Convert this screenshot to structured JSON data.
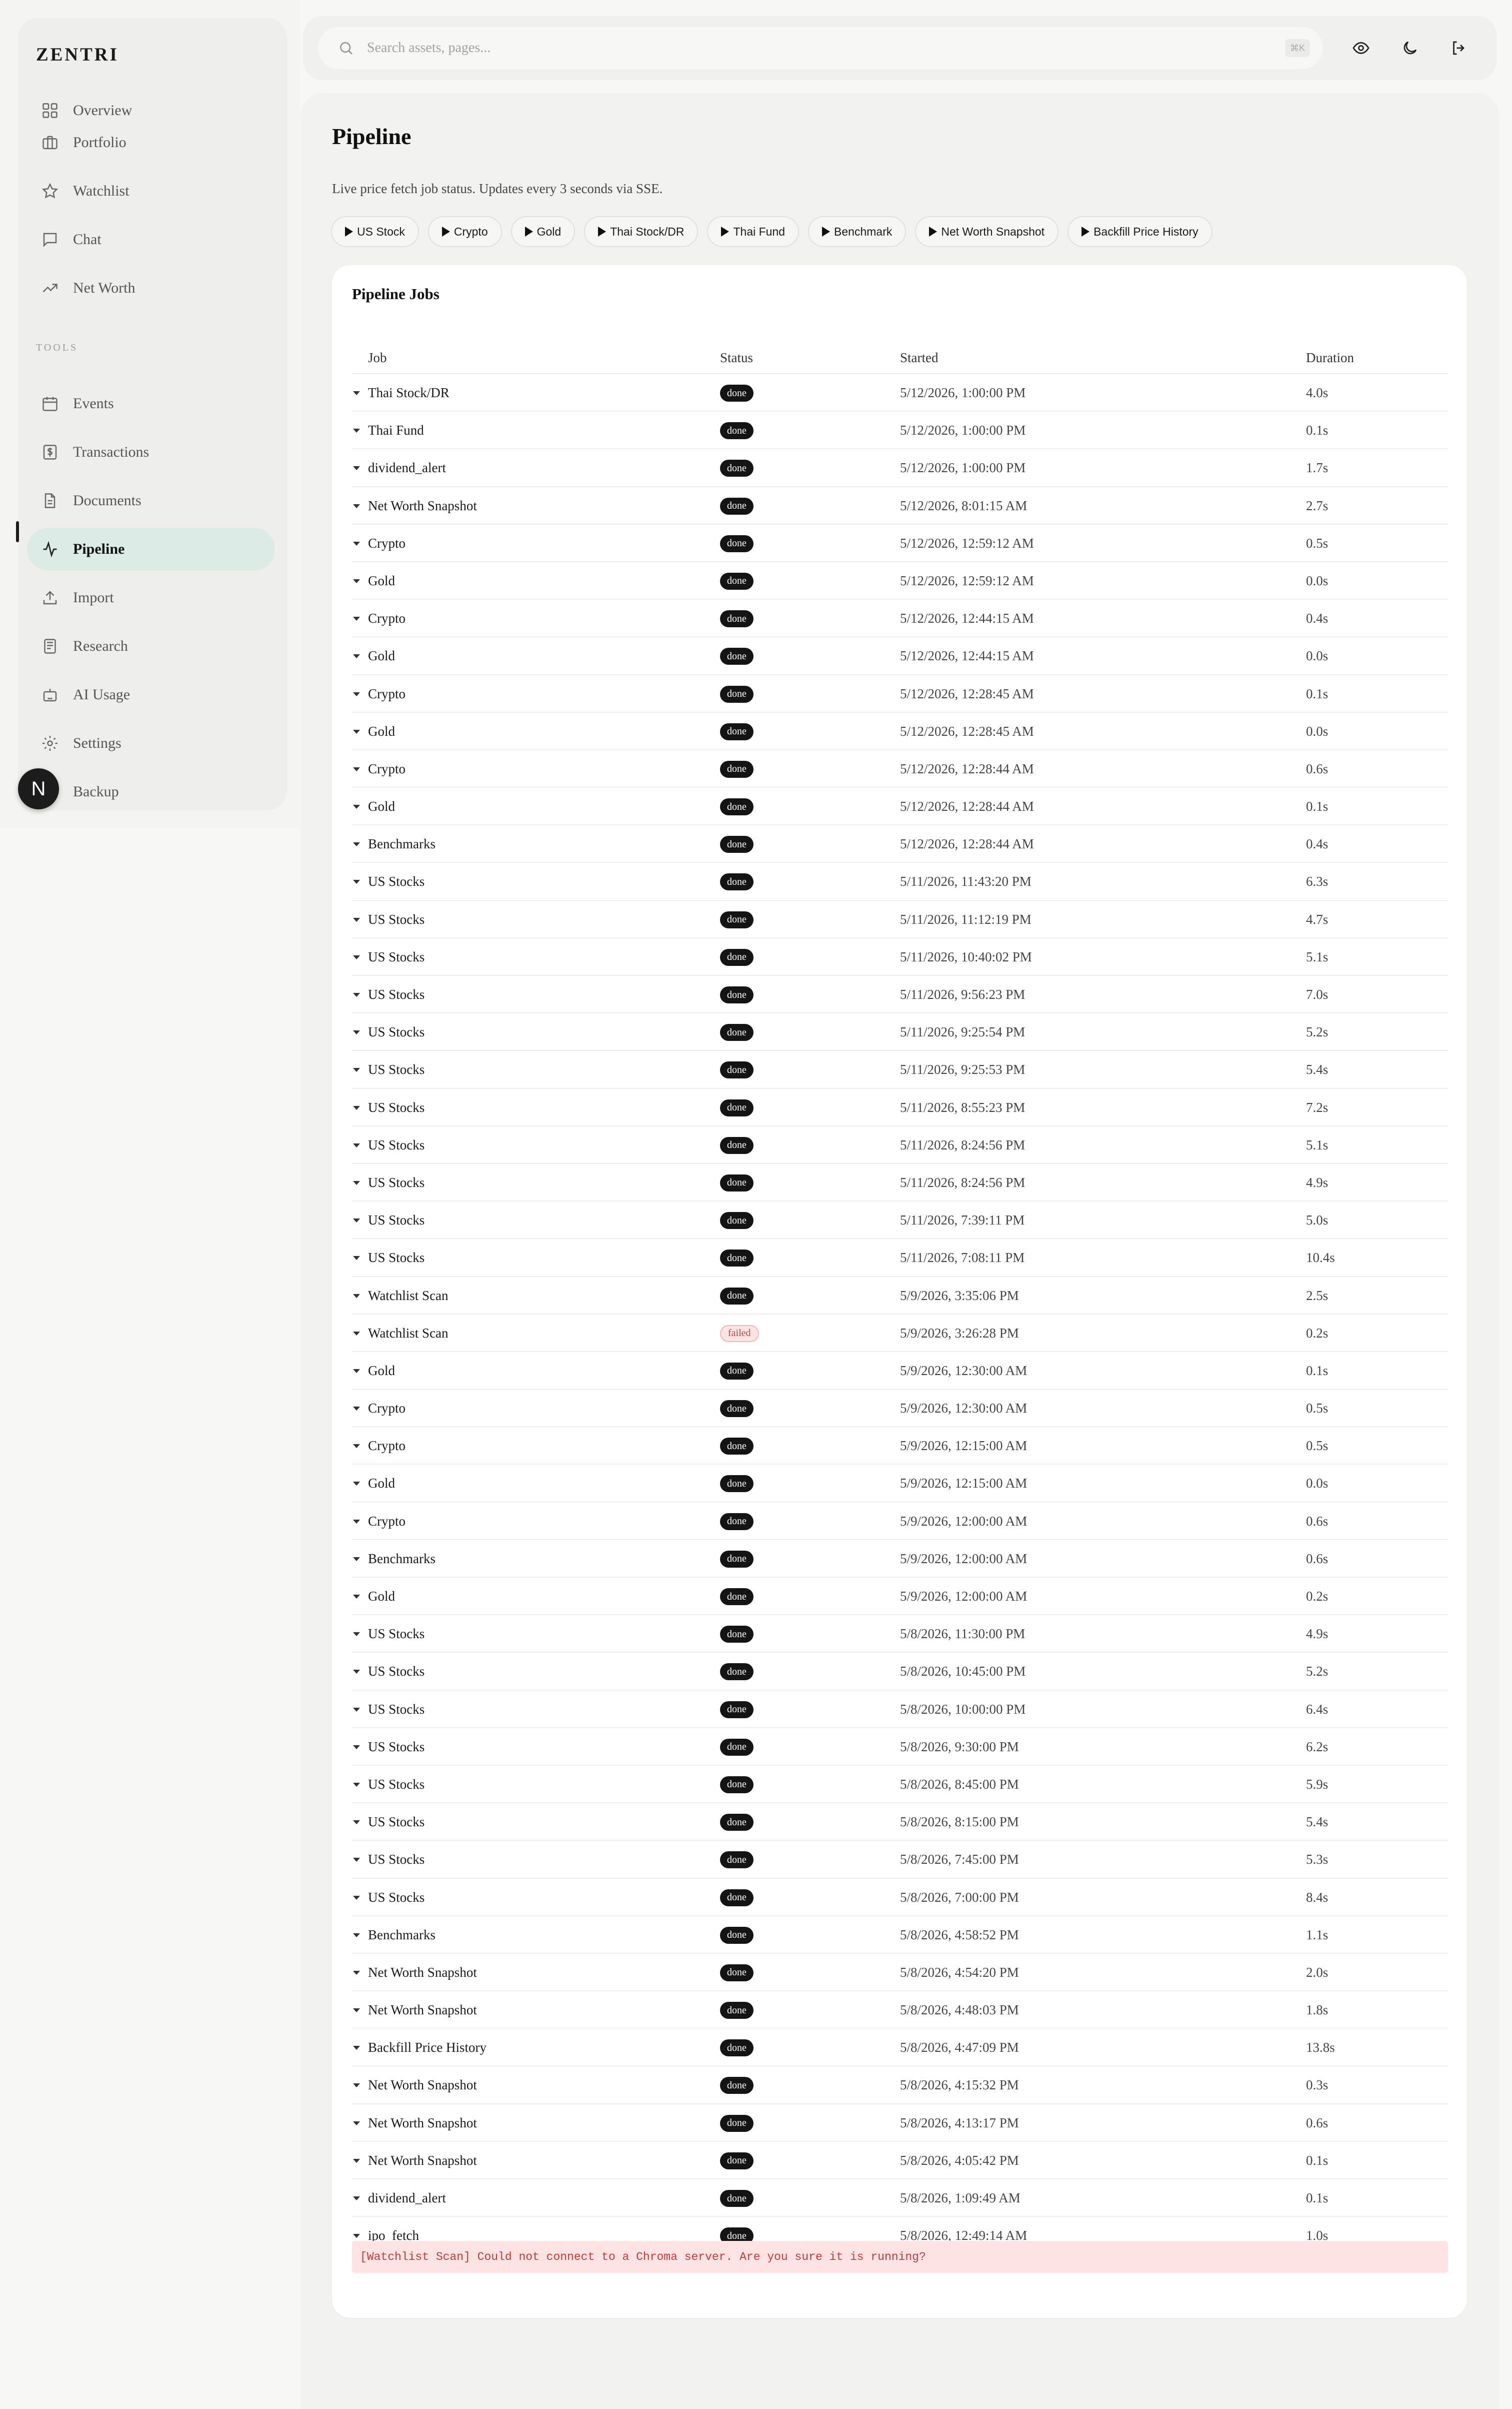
{
  "brand": "ZENTRI",
  "sidebar": {
    "partial_item": "Overview",
    "items": [
      {
        "label": "Portfolio",
        "icon": "briefcase-icon"
      },
      {
        "label": "Watchlist",
        "icon": "star-icon"
      },
      {
        "label": "Chat",
        "icon": "chat-bubble-icon"
      },
      {
        "label": "Net Worth",
        "icon": "trending-up-icon"
      }
    ],
    "section_label": "TOOLS",
    "tools": [
      {
        "label": "Events",
        "icon": "calendar-icon"
      },
      {
        "label": "Transactions",
        "icon": "dollar-receipt-icon"
      },
      {
        "label": "Documents",
        "icon": "document-icon"
      },
      {
        "label": "Pipeline",
        "icon": "activity-icon",
        "active": true
      },
      {
        "label": "Import",
        "icon": "upload-icon"
      },
      {
        "label": "Research",
        "icon": "research-icon"
      },
      {
        "label": "AI Usage",
        "icon": "robot-icon"
      },
      {
        "label": "Settings",
        "icon": "gear-icon"
      },
      {
        "label": "Backup",
        "icon": "database-icon"
      }
    ],
    "user_badge": "N"
  },
  "topbar": {
    "search_placeholder": "Search assets, pages...",
    "shortcut": "⌘K",
    "icons": [
      "eye-icon",
      "moon-icon",
      "logout-icon"
    ]
  },
  "page": {
    "title": "Pipeline",
    "subtitle": "Live price fetch job status. Updates every 3 seconds via SSE.",
    "run_buttons": [
      "US Stock",
      "Crypto",
      "Gold",
      "Thai Stock/DR",
      "Thai Fund",
      "Benchmark",
      "Net Worth Snapshot",
      "Backfill Price History"
    ]
  },
  "jobs_card": {
    "title": "Pipeline Jobs",
    "columns": [
      "Job",
      "Status",
      "Started",
      "Duration"
    ],
    "rows": [
      {
        "job": "Thai Stock/DR",
        "status": "done",
        "started": "5/12/2026, 1:00:00 PM",
        "duration": "4.0s"
      },
      {
        "job": "Thai Fund",
        "status": "done",
        "started": "5/12/2026, 1:00:00 PM",
        "duration": "0.1s"
      },
      {
        "job": "dividend_alert",
        "status": "done",
        "started": "5/12/2026, 1:00:00 PM",
        "duration": "1.7s"
      },
      {
        "job": "Net Worth Snapshot",
        "status": "done",
        "started": "5/12/2026, 8:01:15 AM",
        "duration": "2.7s"
      },
      {
        "job": "Crypto",
        "status": "done",
        "started": "5/12/2026, 12:59:12 AM",
        "duration": "0.5s"
      },
      {
        "job": "Gold",
        "status": "done",
        "started": "5/12/2026, 12:59:12 AM",
        "duration": "0.0s"
      },
      {
        "job": "Crypto",
        "status": "done",
        "started": "5/12/2026, 12:44:15 AM",
        "duration": "0.4s"
      },
      {
        "job": "Gold",
        "status": "done",
        "started": "5/12/2026, 12:44:15 AM",
        "duration": "0.0s"
      },
      {
        "job": "Crypto",
        "status": "done",
        "started": "5/12/2026, 12:28:45 AM",
        "duration": "0.1s"
      },
      {
        "job": "Gold",
        "status": "done",
        "started": "5/12/2026, 12:28:45 AM",
        "duration": "0.0s"
      },
      {
        "job": "Crypto",
        "status": "done",
        "started": "5/12/2026, 12:28:44 AM",
        "duration": "0.6s"
      },
      {
        "job": "Gold",
        "status": "done",
        "started": "5/12/2026, 12:28:44 AM",
        "duration": "0.1s"
      },
      {
        "job": "Benchmarks",
        "status": "done",
        "started": "5/12/2026, 12:28:44 AM",
        "duration": "0.4s"
      },
      {
        "job": "US Stocks",
        "status": "done",
        "started": "5/11/2026, 11:43:20 PM",
        "duration": "6.3s"
      },
      {
        "job": "US Stocks",
        "status": "done",
        "started": "5/11/2026, 11:12:19 PM",
        "duration": "4.7s"
      },
      {
        "job": "US Stocks",
        "status": "done",
        "started": "5/11/2026, 10:40:02 PM",
        "duration": "5.1s"
      },
      {
        "job": "US Stocks",
        "status": "done",
        "started": "5/11/2026, 9:56:23 PM",
        "duration": "7.0s"
      },
      {
        "job": "US Stocks",
        "status": "done",
        "started": "5/11/2026, 9:25:54 PM",
        "duration": "5.2s"
      },
      {
        "job": "US Stocks",
        "status": "done",
        "started": "5/11/2026, 9:25:53 PM",
        "duration": "5.4s"
      },
      {
        "job": "US Stocks",
        "status": "done",
        "started": "5/11/2026, 8:55:23 PM",
        "duration": "7.2s"
      },
      {
        "job": "US Stocks",
        "status": "done",
        "started": "5/11/2026, 8:24:56 PM",
        "duration": "5.1s"
      },
      {
        "job": "US Stocks",
        "status": "done",
        "started": "5/11/2026, 8:24:56 PM",
        "duration": "4.9s"
      },
      {
        "job": "US Stocks",
        "status": "done",
        "started": "5/11/2026, 7:39:11 PM",
        "duration": "5.0s"
      },
      {
        "job": "US Stocks",
        "status": "done",
        "started": "5/11/2026, 7:08:11 PM",
        "duration": "10.4s"
      },
      {
        "job": "Watchlist Scan",
        "status": "done",
        "started": "5/9/2026, 3:35:06 PM",
        "duration": "2.5s"
      },
      {
        "job": "Watchlist Scan",
        "status": "failed",
        "started": "5/9/2026, 3:26:28 PM",
        "duration": "0.2s"
      },
      {
        "job": "Gold",
        "status": "done",
        "started": "5/9/2026, 12:30:00 AM",
        "duration": "0.1s"
      },
      {
        "job": "Crypto",
        "status": "done",
        "started": "5/9/2026, 12:30:00 AM",
        "duration": "0.5s"
      },
      {
        "job": "Crypto",
        "status": "done",
        "started": "5/9/2026, 12:15:00 AM",
        "duration": "0.5s"
      },
      {
        "job": "Gold",
        "status": "done",
        "started": "5/9/2026, 12:15:00 AM",
        "duration": "0.0s"
      },
      {
        "job": "Crypto",
        "status": "done",
        "started": "5/9/2026, 12:00:00 AM",
        "duration": "0.6s"
      },
      {
        "job": "Benchmarks",
        "status": "done",
        "started": "5/9/2026, 12:00:00 AM",
        "duration": "0.6s"
      },
      {
        "job": "Gold",
        "status": "done",
        "started": "5/9/2026, 12:00:00 AM",
        "duration": "0.2s"
      },
      {
        "job": "US Stocks",
        "status": "done",
        "started": "5/8/2026, 11:30:00 PM",
        "duration": "4.9s"
      },
      {
        "job": "US Stocks",
        "status": "done",
        "started": "5/8/2026, 10:45:00 PM",
        "duration": "5.2s"
      },
      {
        "job": "US Stocks",
        "status": "done",
        "started": "5/8/2026, 10:00:00 PM",
        "duration": "6.4s"
      },
      {
        "job": "US Stocks",
        "status": "done",
        "started": "5/8/2026, 9:30:00 PM",
        "duration": "6.2s"
      },
      {
        "job": "US Stocks",
        "status": "done",
        "started": "5/8/2026, 8:45:00 PM",
        "duration": "5.9s"
      },
      {
        "job": "US Stocks",
        "status": "done",
        "started": "5/8/2026, 8:15:00 PM",
        "duration": "5.4s"
      },
      {
        "job": "US Stocks",
        "status": "done",
        "started": "5/8/2026, 7:45:00 PM",
        "duration": "5.3s"
      },
      {
        "job": "US Stocks",
        "status": "done",
        "started": "5/8/2026, 7:00:00 PM",
        "duration": "8.4s"
      },
      {
        "job": "Benchmarks",
        "status": "done",
        "started": "5/8/2026, 4:58:52 PM",
        "duration": "1.1s"
      },
      {
        "job": "Net Worth Snapshot",
        "status": "done",
        "started": "5/8/2026, 4:54:20 PM",
        "duration": "2.0s"
      },
      {
        "job": "Net Worth Snapshot",
        "status": "done",
        "started": "5/8/2026, 4:48:03 PM",
        "duration": "1.8s"
      },
      {
        "job": "Backfill Price History",
        "status": "done",
        "started": "5/8/2026, 4:47:09 PM",
        "duration": "13.8s"
      },
      {
        "job": "Net Worth Snapshot",
        "status": "done",
        "started": "5/8/2026, 4:15:32 PM",
        "duration": "0.3s"
      },
      {
        "job": "Net Worth Snapshot",
        "status": "done",
        "started": "5/8/2026, 4:13:17 PM",
        "duration": "0.6s"
      },
      {
        "job": "Net Worth Snapshot",
        "status": "done",
        "started": "5/8/2026, 4:05:42 PM",
        "duration": "0.1s"
      },
      {
        "job": "dividend_alert",
        "status": "done",
        "started": "5/8/2026, 1:09:49 AM",
        "duration": "0.1s"
      },
      {
        "job": "ipo_fetch",
        "status": "done",
        "started": "5/8/2026, 12:49:14 AM",
        "duration": "1.0s"
      }
    ],
    "error_message": "[Watchlist Scan] Could not connect to a Chroma server. Are you sure it is running?"
  }
}
